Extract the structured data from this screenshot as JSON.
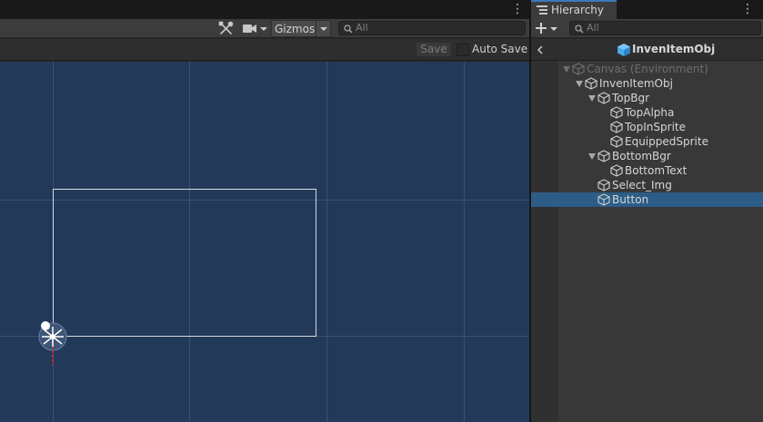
{
  "scene": {
    "menu_icon": "more-vert-icon",
    "toolbar": {
      "tools_icon": "tools-icon",
      "camera_icon": "camera-icon",
      "gizmos_label": "Gizmos",
      "search_placeholder": "All"
    },
    "prefab_bar": {
      "save_label": "Save",
      "autosave_label": "Auto Save",
      "autosave_checked": false
    }
  },
  "hierarchy": {
    "tab_label": "Hierarchy",
    "tab_icon": "hierarchy-icon",
    "create_icon": "plus-icon",
    "search_placeholder": "All",
    "prefab_title": "InvenItemObj",
    "items": [
      {
        "label": "Canvas (Environment)",
        "depth": 0,
        "expanded": true,
        "muted": true,
        "selected": false
      },
      {
        "label": "InvenItemObj",
        "depth": 1,
        "expanded": true,
        "muted": false,
        "selected": false
      },
      {
        "label": "TopBgr",
        "depth": 2,
        "expanded": true,
        "muted": false,
        "selected": false
      },
      {
        "label": "TopAlpha",
        "depth": 3,
        "expanded": null,
        "muted": false,
        "selected": false
      },
      {
        "label": "TopInSprite",
        "depth": 3,
        "expanded": null,
        "muted": false,
        "selected": false
      },
      {
        "label": "EquippedSprite",
        "depth": 3,
        "expanded": null,
        "muted": false,
        "selected": false
      },
      {
        "label": "BottomBgr",
        "depth": 2,
        "expanded": true,
        "muted": false,
        "selected": false
      },
      {
        "label": "BottomText",
        "depth": 3,
        "expanded": null,
        "muted": false,
        "selected": false
      },
      {
        "label": "Select_Img",
        "depth": 2,
        "expanded": null,
        "muted": false,
        "selected": false
      },
      {
        "label": "Button",
        "depth": 2,
        "expanded": null,
        "muted": false,
        "selected": true
      }
    ]
  },
  "colors": {
    "scene_background": "#22395a",
    "grid_line": "#3a5170",
    "selection": "#2c5d87",
    "accent": "#3a79bb"
  }
}
